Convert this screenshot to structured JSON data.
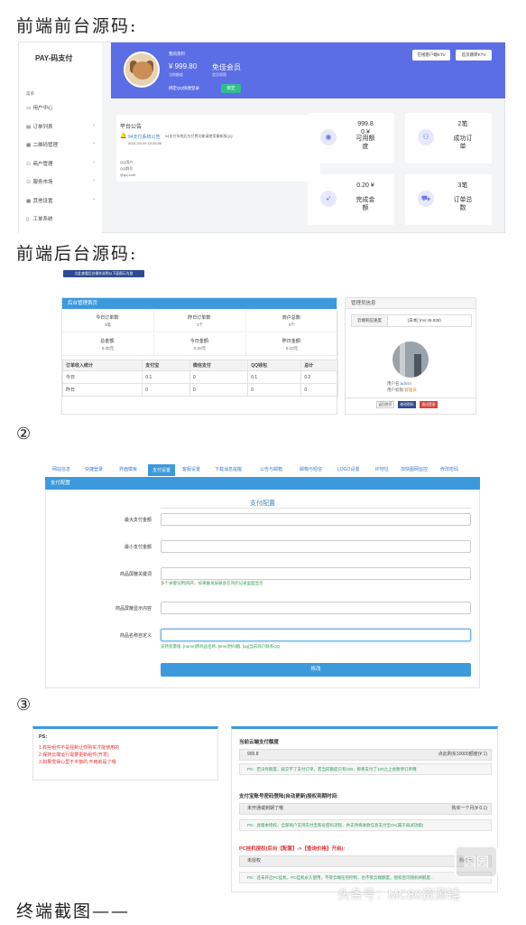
{
  "headings": {
    "frontend": "前端前台源码:",
    "backend": "前端后台源码:",
    "circle2": "②",
    "circle3": "③",
    "footer": "终端截图——"
  },
  "s1": {
    "brand": "PAY-码支付",
    "group": "菜单",
    "menu": [
      {
        "icon": "monitor-icon",
        "label": "用户中心",
        "arrow": ""
      },
      {
        "icon": "doc-icon",
        "label": "订单列表",
        "arrow": "›"
      },
      {
        "icon": "grid-icon",
        "label": "二维码管理",
        "arrow": "›"
      },
      {
        "icon": "users-icon",
        "label": "商户管理",
        "arrow": "›"
      },
      {
        "icon": "users-icon",
        "label": "服务市场",
        "arrow": "›"
      },
      {
        "icon": "grid-icon",
        "label": "其他设置",
        "arrow": "›"
      },
      {
        "icon": "note-icon",
        "label": "工单系统",
        "arrow": ""
      }
    ],
    "banner": {
      "greeting": "我的资料",
      "balance": "¥ 999.80",
      "member": "免佳会员",
      "bal_sub": "当前额度",
      "mem_sub": "会员权限",
      "bind": "绑定QQ快捷登录",
      "bind_btn": "绑定",
      "btn1": "在线客户端KTV",
      "btn2": "首页跳转KTV"
    },
    "notice": {
      "title": "平台公告",
      "item": "94支付系统公告",
      "date": "2021-09-09 10:26:05",
      "text": "94支付系统后台付费功能请使用最新版QQ",
      "qq": "QQ用户",
      "qq2": "QQ群号",
      "email": "@qq.com"
    },
    "stats": [
      {
        "icon": "coin-icon",
        "value": "999.8\n0 ¥",
        "label": "可用额\n度"
      },
      {
        "icon": "user-add-icon",
        "value": "2笔",
        "label": "成功订\n单"
      },
      {
        "icon": "rocket-icon",
        "value": "0.20 ¥",
        "label": "完成金\n额"
      },
      {
        "icon": "cart-icon",
        "value": "3笔",
        "label": "订单总\n数"
      }
    ]
  },
  "s2": {
    "top_btn": "点此查看后台操作说明以下面图示为准",
    "title": "后台管理首页",
    "row1": [
      "今日订单数:",
      "昨日订单数:",
      "商户总数:"
    ],
    "row1v": [
      "3笔",
      "1个",
      "5个"
    ],
    "row2": [
      "总金额:",
      "今日金额:",
      "昨日金额:"
    ],
    "row2v": [
      "0.30元",
      "0.20元",
      "0.10元"
    ],
    "table_head": [
      "订单收入统计",
      "支付宝",
      "微信支付",
      "QQ钱包",
      "总计"
    ],
    "table_rows": [
      [
        "今日",
        "0.1",
        "0",
        "0.1",
        "0.2"
      ],
      [
        "昨日",
        "0",
        "0",
        "0",
        "0"
      ]
    ],
    "admin_title": "管理员信息",
    "server_label": "云端响应速度",
    "server_val": "[日本] (ms:45.835)",
    "admin_name_l": "用户名:",
    "admin_name": "admin",
    "admin_role_l": "用户权限:",
    "admin_role": "管理员",
    "abtn": [
      "返回首页",
      "修改密码",
      "退出登录"
    ]
  },
  "s3": {
    "tabs": [
      "网站信息",
      "快捷登录",
      "界面模板",
      "支付设置",
      "客服设置",
      "下载消息提醒",
      "公告与邮箱",
      "邮箱与短信",
      "LOGO设置",
      "IP地址",
      "加快图网监控",
      "修改密码"
    ],
    "active_tab": 3,
    "header": "支付配置",
    "form_title": "支付配置",
    "fields": [
      {
        "label": "最大支付金额",
        "value": ""
      },
      {
        "label": "最小支付金额",
        "value": ""
      },
      {
        "label": "商品屏蔽关键词",
        "value": ""
      },
      {
        "label": "商品屏蔽显示内容",
        "value": ""
      },
      {
        "label": "商品名称自定义",
        "value": ""
      }
    ],
    "hint1": "多个关键词用|隔开。如果触发屏蔽会在风控记录里面显示",
    "hint2": "支持变量值: [name]原商品名称, [time]时间戳, [qq]当前商户联系QQ",
    "submit": "修改"
  },
  "s4": {
    "ps": "PS:",
    "ps_lines": [
      "1.有些组件不是强制让你购买才能使用的",
      "2.保持云端运行需要更新组件(开发)",
      "3.如果觉得心里不平衡的,不用就是了哦"
    ],
    "cloud_title": "当前云端支付额度",
    "cloud_val": "999.8",
    "cloud_right": "点此购买10000额度(¥ 1)",
    "cloud_note": "PS：若没有额度，就交不了支付订单，若当前额度只有100，那将支付了100之上会暂停订单哦",
    "alipay_title": "支付宝账号密码登陆(自动更新)授权到期时间:",
    "alipay_val": "未开通或到期了哦",
    "alipay_right": "购买一个月(¥ 0.1)",
    "alipay_note": "PS：此版本授权，全部商户支持支付宝和号密码流程，并支持将收款信息支付宝CK(属于再试功能)",
    "pc_title": "PC挂机授权(后台【配置】->【查询价格】开启):",
    "pc_val": "未授权",
    "pc_right": "购买永",
    "pc_note": "PS：还未开启PC挂机，PC挂机永久使用，不受云端任何控制，也不受云端额度，授权后可随机将额度..."
  },
  "watermark": "头条号：MC80资源铺",
  "watermark_logo": "园园"
}
